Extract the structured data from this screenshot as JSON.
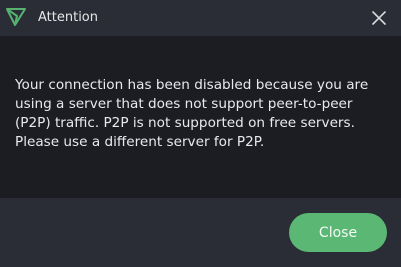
{
  "dialog": {
    "title": "Attention",
    "message": "Your connection has been disabled because you are using a server that does not support peer-to-peer (P2P) traffic. P2P is not supported on free servers. Please use a different server for P2P.",
    "close_button_label": "Close"
  },
  "icons": {
    "app": "protonvpn-logo-icon",
    "window_close": "close-icon"
  },
  "colors": {
    "titlebar_bg": "#2a2d35",
    "content_bg": "#1b1d23",
    "accent_green": "#5bb774",
    "text": "#e9eaed"
  }
}
